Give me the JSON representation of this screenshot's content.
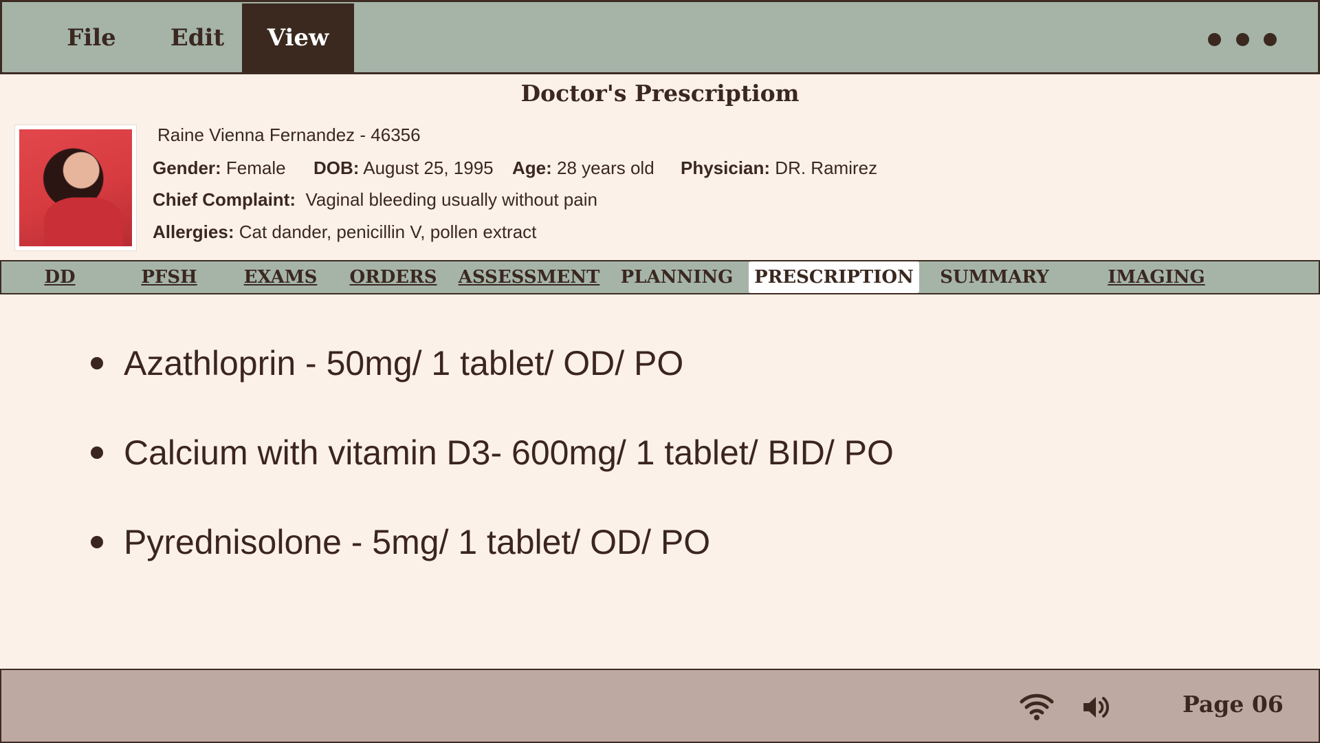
{
  "menu": {
    "items": [
      {
        "label": "File",
        "active": false
      },
      {
        "label": "Edit",
        "active": false
      },
      {
        "label": "View",
        "active": true
      }
    ],
    "more_icon": "more-horizontal-icon"
  },
  "page_title": "Doctor's Prescriptiom",
  "patient": {
    "name_id": "Raine Vienna Fernandez - 46356",
    "gender_label": "Gender:",
    "gender": "Female",
    "dob_label": "DOB:",
    "dob": "August  25, 1995",
    "age_label": "Age:",
    "age": "28 years old",
    "physician_label": "Physician:",
    "physician": "DR. Ramirez",
    "complaint_label": "Chief Complaint:",
    "complaint": "Vaginal bleeding usually without pain",
    "allergies_label": "Allergies:",
    "allergies": "Cat dander, penicillin V, pollen extract"
  },
  "tabs": [
    {
      "label": "DD",
      "active": false
    },
    {
      "label": "PFSH",
      "active": false
    },
    {
      "label": "EXAMS",
      "active": false
    },
    {
      "label": "ORDERS",
      "active": false
    },
    {
      "label": "ASSESSMENT",
      "active": false
    },
    {
      "label": "PLANNING",
      "active": false
    },
    {
      "label": "PRESCRIPTION",
      "active": true
    },
    {
      "label": "SUMMARY",
      "active": false
    },
    {
      "label": "IMAGING",
      "active": false
    }
  ],
  "prescriptions": [
    "Azathloprin - 50mg/ 1 tablet/ OD/ PO",
    "Calcium with vitamin D3- 600mg/ 1 tablet/ BID/ PO",
    "Pyrednisolone - 5mg/ 1 tablet/ OD/ PO"
  ],
  "footer": {
    "wifi_icon": "wifi-icon",
    "volume_icon": "volume-icon",
    "page_label": "Page 06"
  },
  "colors": {
    "background": "#fcf1e9",
    "bar_green": "#a6b4a8",
    "dark_brown": "#3b2920",
    "footer_mauve": "#bda9a1"
  }
}
